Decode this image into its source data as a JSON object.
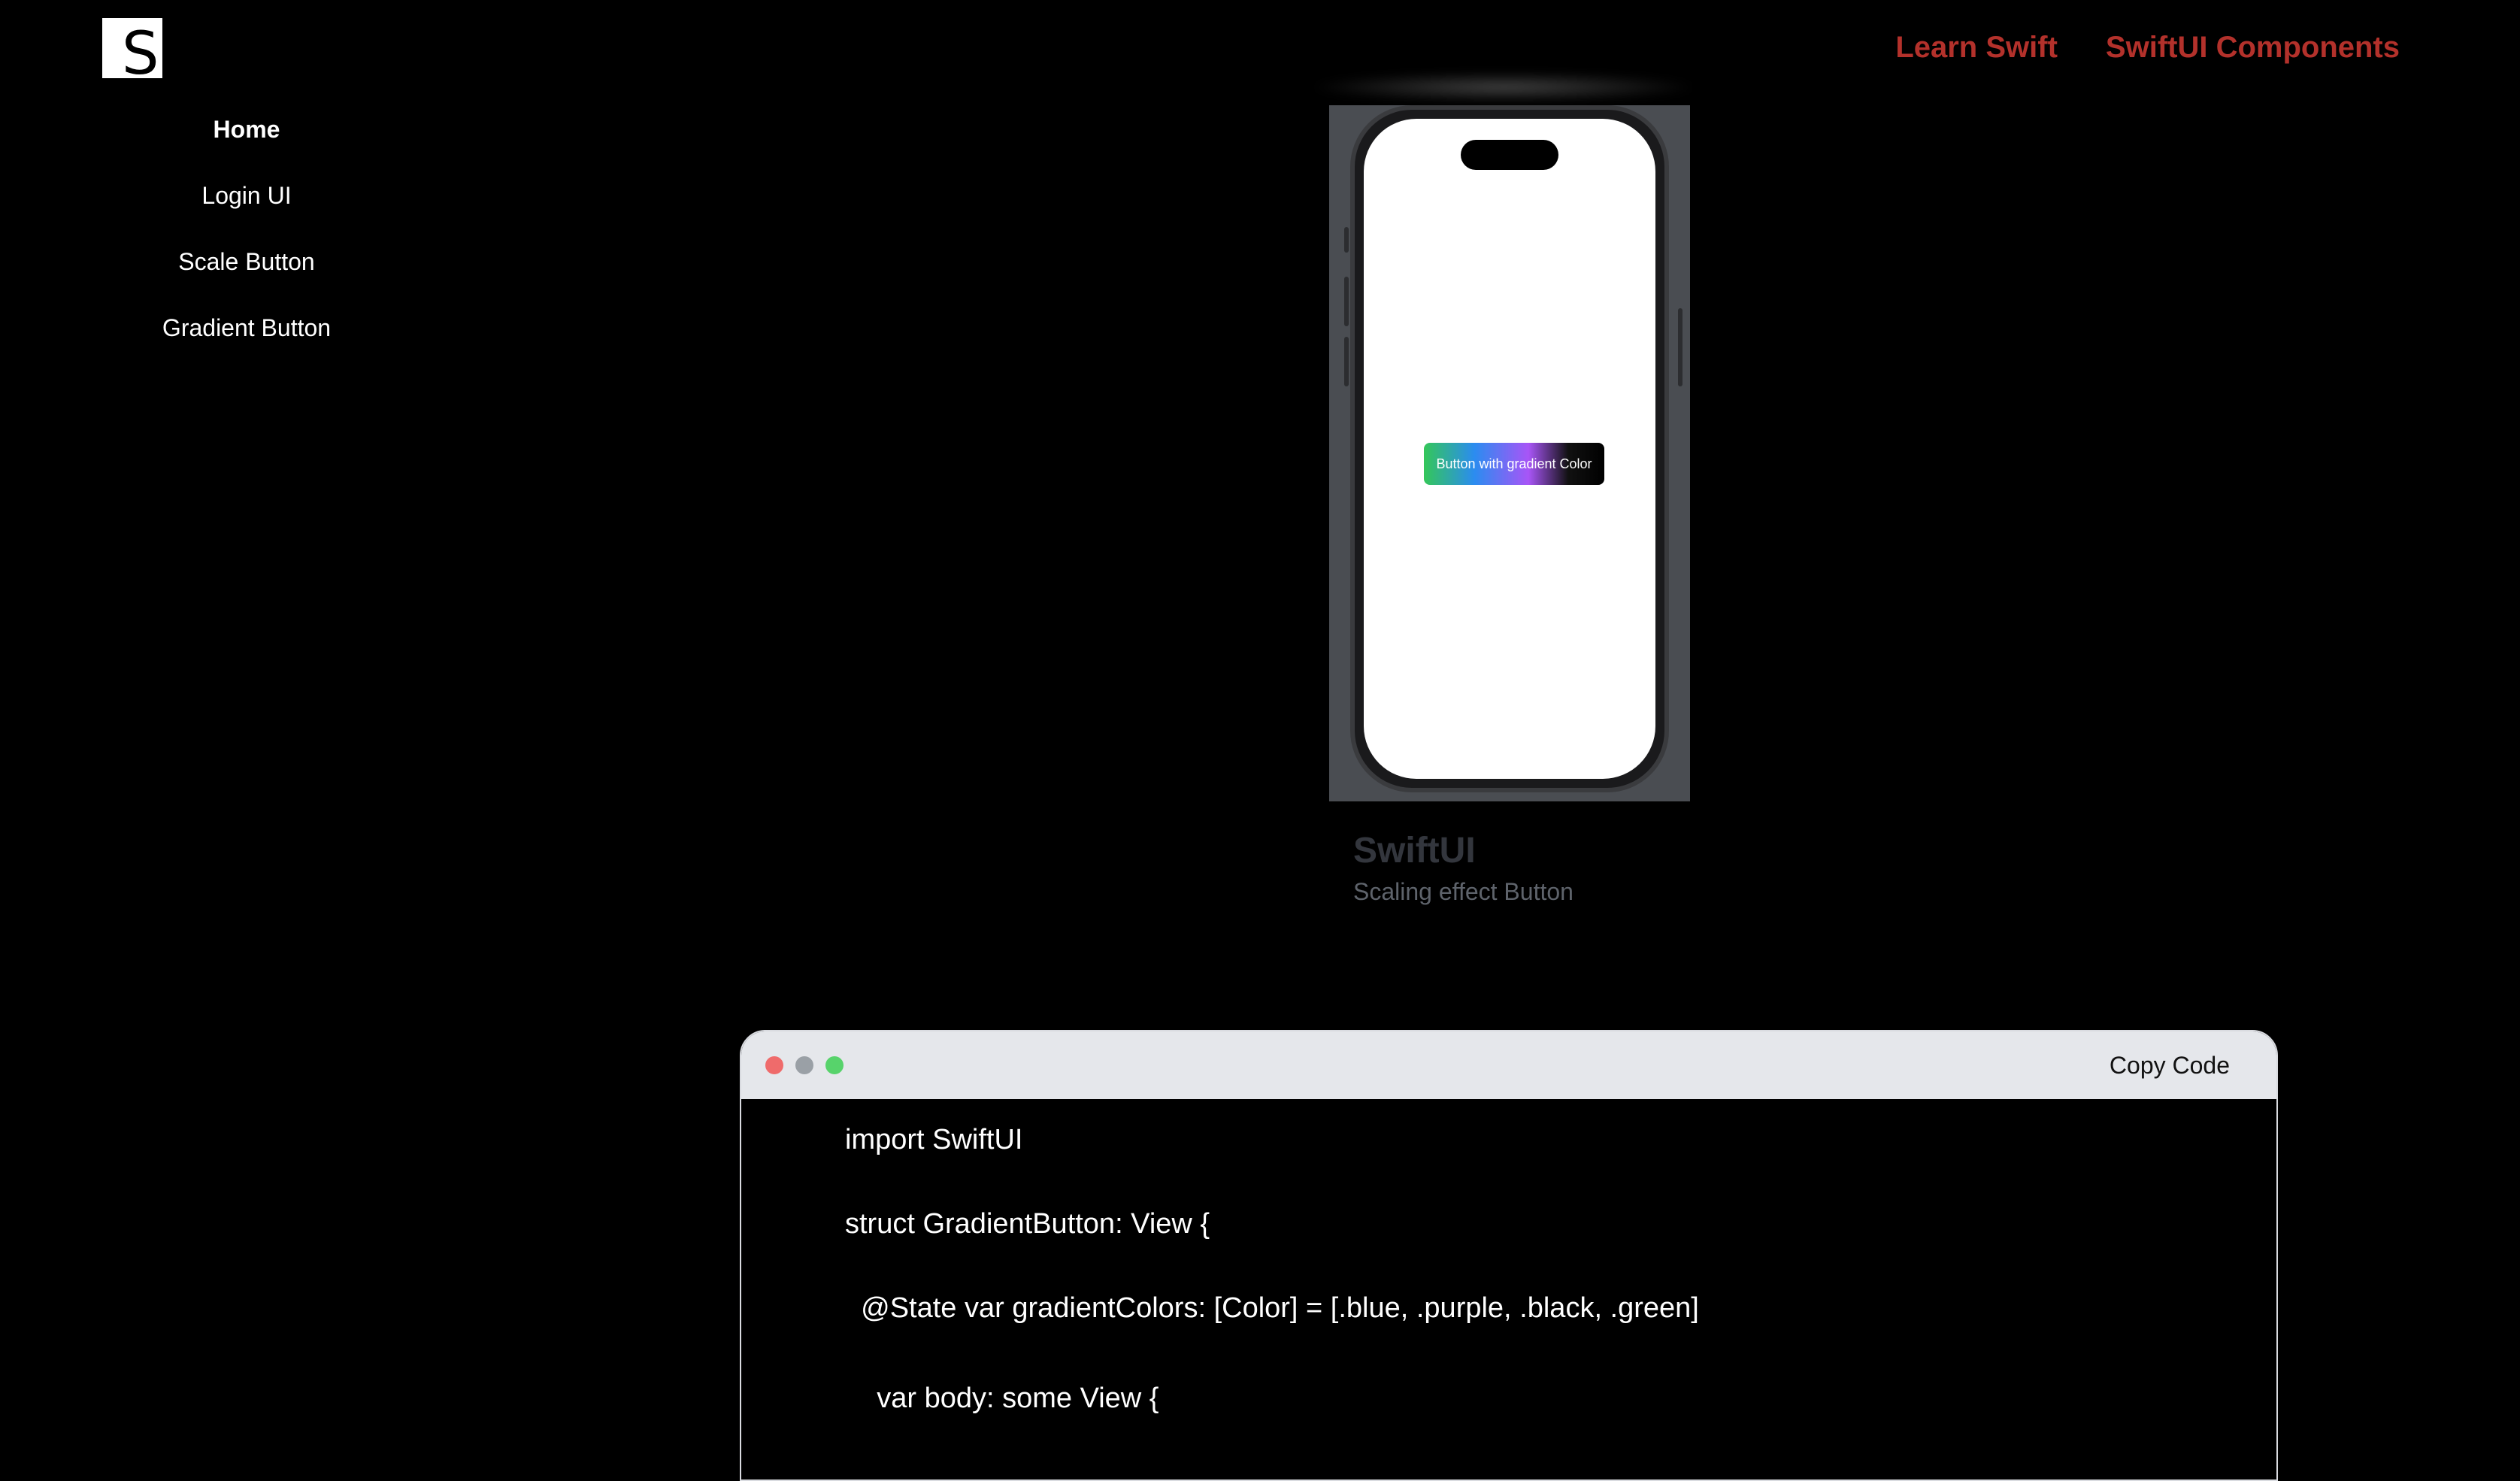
{
  "logo": {
    "letter": "S"
  },
  "topnav": {
    "items": [
      "Learn Swift",
      "SwiftUI Components"
    ]
  },
  "sidebar": {
    "items": [
      "Home",
      "Login UI",
      "Scale Button",
      "Gradient Button"
    ]
  },
  "preview": {
    "button_label": "Button with gradient Color",
    "title": "SwiftUI",
    "subtitle": "Scaling effect Button"
  },
  "code_window": {
    "copy_label": "Copy Code",
    "dot_colors": [
      "#ef6b6b",
      "#9aa0a6",
      "#57d36b"
    ],
    "lines": [
      "import SwiftUI",
      "struct GradientButton: View {",
      "  @State var gradientColors: [Color] = [.blue, .purple, .black, .green]",
      "    var body: some View {"
    ]
  },
  "colors": {
    "accent": "#b3312b",
    "background": "#000000"
  }
}
